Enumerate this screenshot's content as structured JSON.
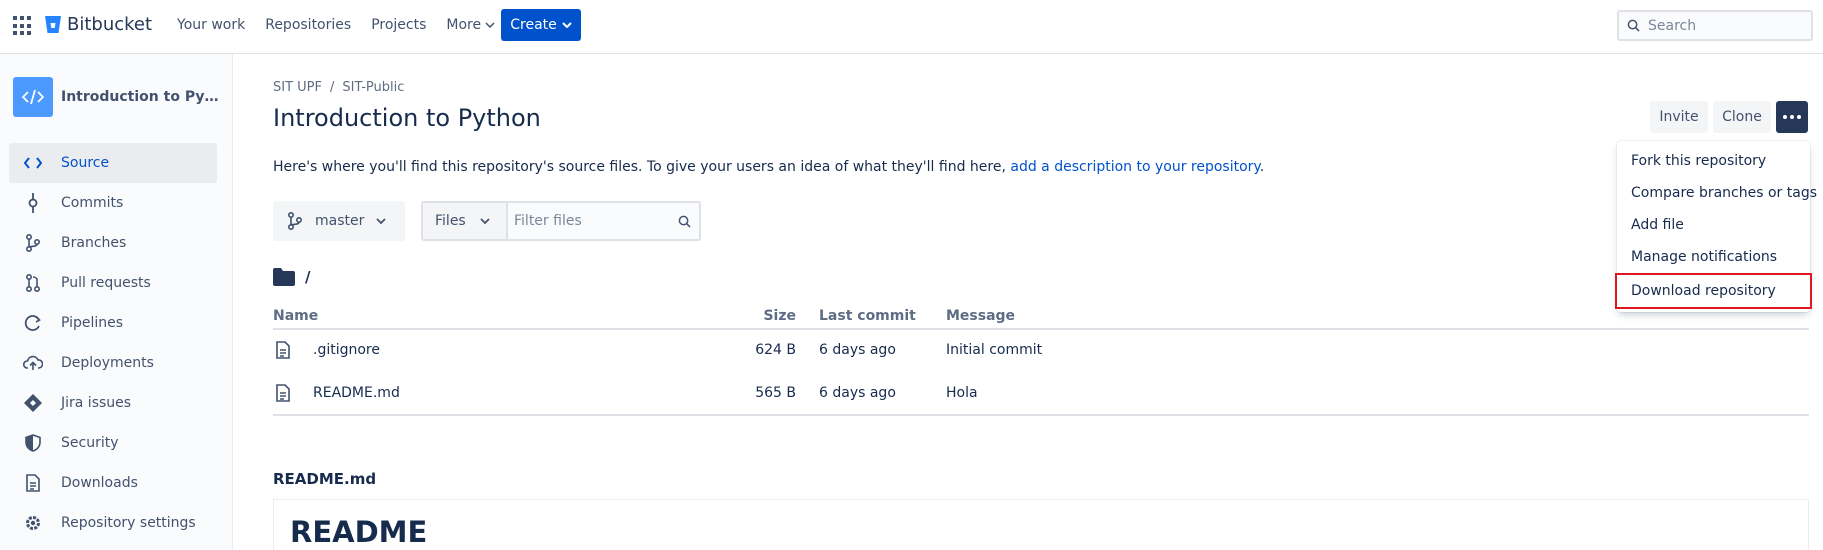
{
  "topbar": {
    "brand": "Bitbucket",
    "nav": [
      "Your work",
      "Repositories",
      "Projects",
      "More"
    ],
    "create_label": "Create",
    "search_placeholder": "Search"
  },
  "sidebar": {
    "repo_name": "Introduction to Pyth...",
    "items": [
      {
        "label": "Source",
        "icon": "source-code-icon",
        "active": true
      },
      {
        "label": "Commits",
        "icon": "commit-icon"
      },
      {
        "label": "Branches",
        "icon": "branch-icon"
      },
      {
        "label": "Pull requests",
        "icon": "pull-request-icon"
      },
      {
        "label": "Pipelines",
        "icon": "pipeline-icon"
      },
      {
        "label": "Deployments",
        "icon": "cloud-upload-icon"
      },
      {
        "label": "Jira issues",
        "icon": "jira-icon"
      },
      {
        "label": "Security",
        "icon": "shield-icon"
      },
      {
        "label": "Downloads",
        "icon": "document-icon"
      },
      {
        "label": "Repository settings",
        "icon": "gear-icon"
      }
    ]
  },
  "main": {
    "breadcrumb": [
      "SIT UPF",
      "SIT-Public"
    ],
    "title": "Introduction to Python",
    "actions": {
      "invite": "Invite",
      "clone": "Clone"
    },
    "description_prefix": "Here's where you'll find this repository's source files. To give your users an idea of what they'll find here, ",
    "description_link": "add a description to your repository",
    "description_suffix": ".",
    "branch": "master",
    "file_type": "Files",
    "filter_placeholder": "Filter files",
    "path": "/",
    "table": {
      "headers": {
        "name": "Name",
        "size": "Size",
        "last_commit": "Last commit",
        "message": "Message"
      },
      "rows": [
        {
          "name": ".gitignore",
          "size": "624 B",
          "last_commit": "6 days ago",
          "message": "Initial commit"
        },
        {
          "name": "README.md",
          "size": "565 B",
          "last_commit": "6 days ago",
          "message": "Hola"
        }
      ]
    },
    "readme_label": "README.md",
    "readme_heading": "README"
  },
  "menu": {
    "items": [
      "Fork this repository",
      "Compare branches or tags",
      "Add file",
      "Manage notifications",
      "Download repository"
    ],
    "highlighted": "Download repository"
  },
  "colors": {
    "accent": "#0052cc",
    "dark_button": "#253858",
    "highlight_border": "#e0161e"
  }
}
